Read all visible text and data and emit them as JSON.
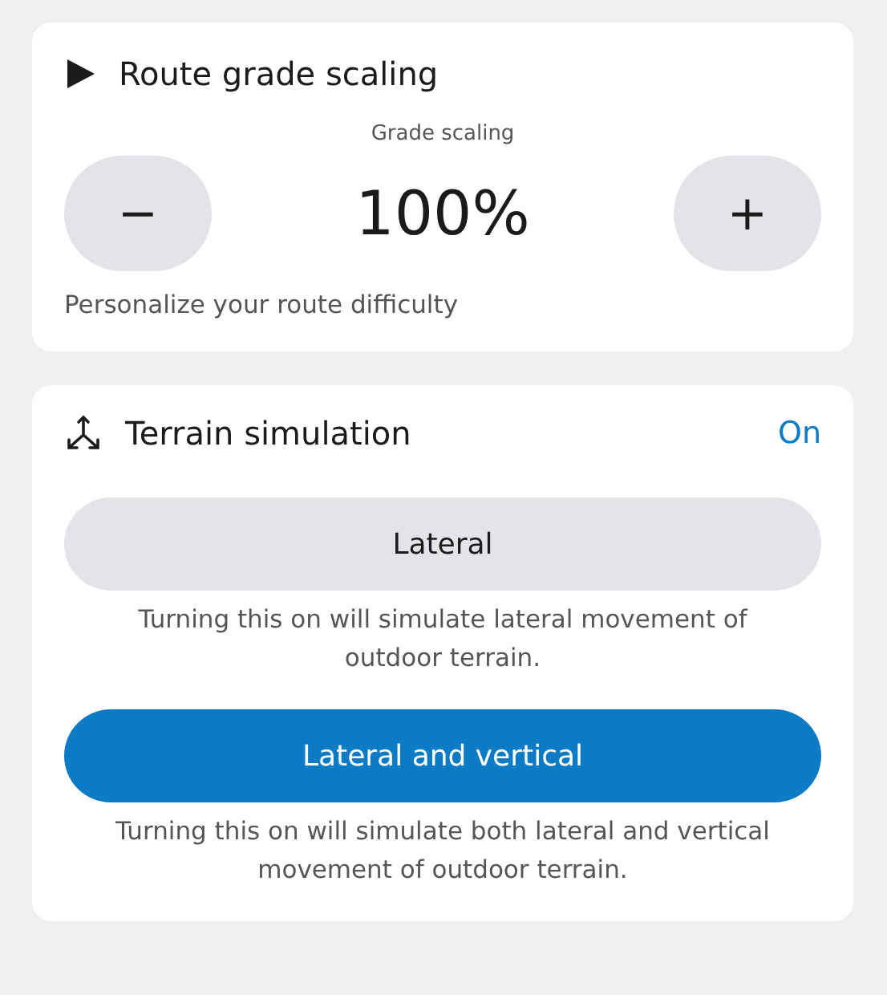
{
  "grade_card": {
    "title": "Route grade scaling",
    "value_label": "Grade scaling",
    "decrease_button": "−",
    "value": "100%",
    "increase_button": "+",
    "caption": "Personalize your route difficulty"
  },
  "terrain_card": {
    "title": "Terrain simulation",
    "status": "On",
    "options": [
      {
        "label": "Lateral",
        "selected": false,
        "description": "Turning this on will simulate lateral movement of outdoor terrain."
      },
      {
        "label": "Lateral and vertical",
        "selected": true,
        "description": "Turning this on will simulate both lateral and vertical movement of outdoor terrain."
      }
    ]
  }
}
